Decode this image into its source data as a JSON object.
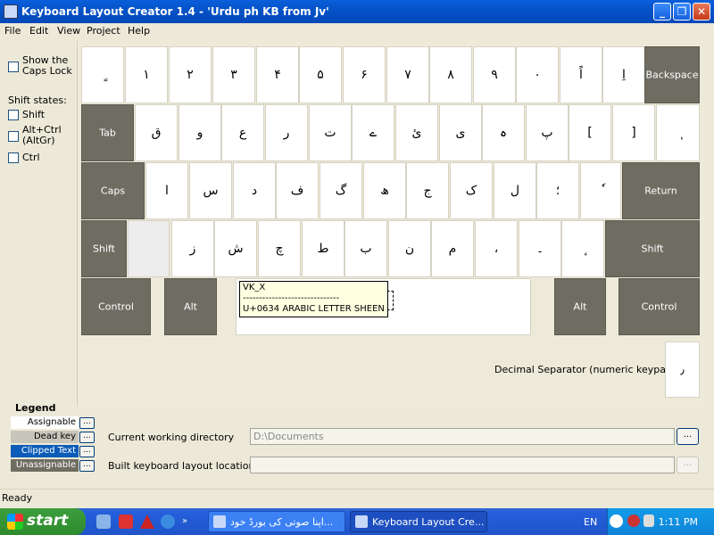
{
  "window": {
    "title": "Keyboard Layout Creator 1.4 - 'Urdu ph KB from Jv'",
    "min_glyph": "_",
    "max_glyph": "❐",
    "close_glyph": "✕"
  },
  "menu": [
    "File",
    "Edit",
    "View",
    "Project",
    "Help"
  ],
  "left": {
    "show_caps_lock": "Show the Caps Lock",
    "shift_states_title": "Shift states:",
    "shift": "Shift",
    "altctrl": "Alt+Ctrl (AltGr)",
    "ctrl": "Ctrl"
  },
  "keyboard": {
    "row1": [
      "ٍ",
      "۱",
      "۲",
      "۳",
      "۴",
      "۵",
      "۶",
      "۷",
      "۸",
      "۹",
      "۰",
      "اً",
      "اِ"
    ],
    "backspace": "Backspace",
    "tab": "Tab",
    "row2": [
      "ق",
      "و",
      "ع",
      "ر",
      "ت",
      "ے",
      "ئ",
      "ی",
      "ہ",
      "پ",
      "[",
      "]",
      "ٖ"
    ],
    "caps": "Caps",
    "row3": [
      "ا",
      "س",
      "د",
      "ف",
      "گ",
      "ھ",
      "ج",
      "ک",
      "ل",
      "؛",
      "ٗ"
    ],
    "return": "Return",
    "shift_left": "Shift",
    "row4": [
      "",
      "ز",
      "ش",
      "چ",
      "ط",
      "ب",
      "ن",
      "م",
      "،",
      "۔",
      "ٕ"
    ],
    "shift_right": "Shift",
    "control_left": "Control",
    "alt_left": "Alt",
    "alt_right": "Alt",
    "control_right": "Control",
    "decimal_label": "Decimal Separator (numeric keypad)",
    "decimal_key": "٫"
  },
  "tooltip": {
    "line1": "VK_X",
    "line2": "------------------------------",
    "line3": "U+0634   ARABIC LETTER SHEEN"
  },
  "legend": {
    "title": "Legend",
    "items": [
      {
        "label": "Assignable",
        "bg": "#FFFFFF",
        "fg": "#000000"
      },
      {
        "label": "Dead key",
        "bg": "#C8C6BB",
        "fg": "#000000"
      },
      {
        "label": "Clipped Text",
        "bg": "#0B5CB8",
        "fg": "#FFFFFF"
      },
      {
        "label": "Unassignable",
        "bg": "#6F6D62",
        "fg": "#FFFFFF"
      }
    ],
    "btn": "..."
  },
  "paths": {
    "cwd_label": "Current working directory",
    "cwd_value": "D:\\Documents",
    "built_label": "Built keyboard layout location",
    "built_value": "",
    "browse": "..."
  },
  "status": "Ready",
  "taskbar": {
    "start": "start",
    "task1": "اپنا صوتی کی بورڈ خود...",
    "task2": "Keyboard Layout Cre...",
    "lang": "EN",
    "clock": "1:11 PM"
  }
}
